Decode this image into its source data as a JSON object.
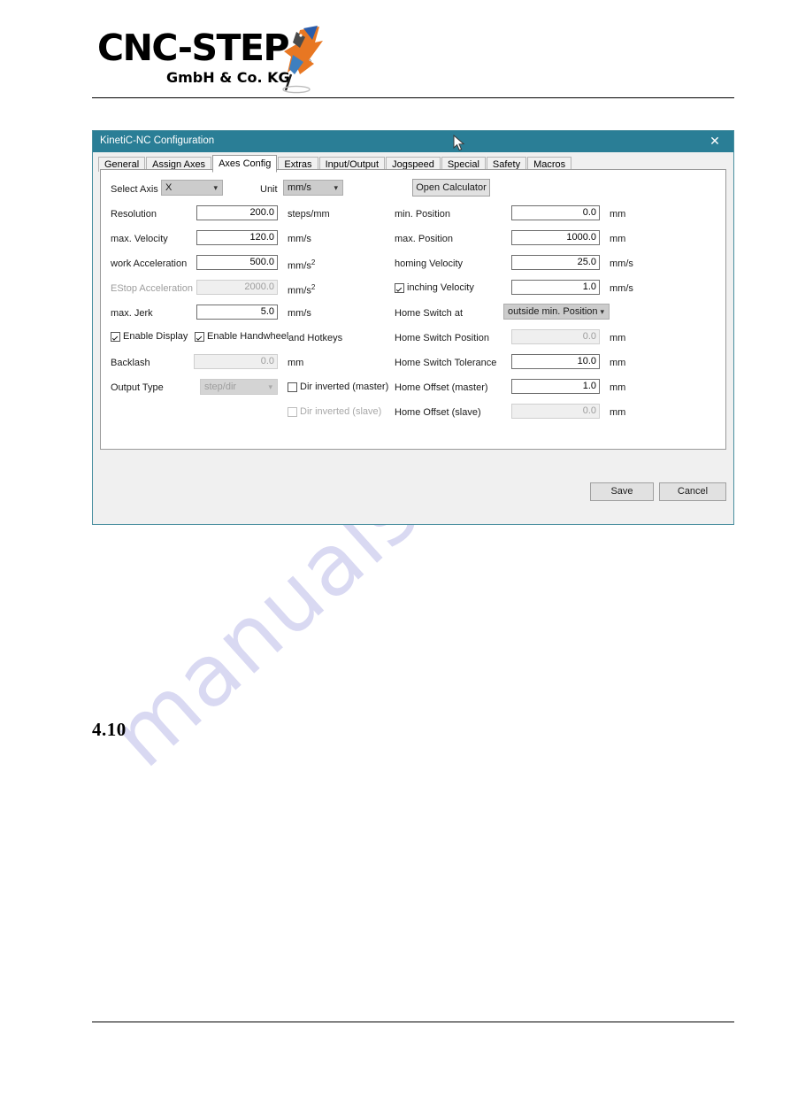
{
  "document": {
    "logo": {
      "main_text": "CNC-STEP",
      "sub_text": "GmbH & Co. KG",
      "registered_mark": "®",
      "bird_icon_name": "kingfisher-logo-icon"
    },
    "watermark_text": "manualshive.com",
    "section_number": "4.10"
  },
  "dialog": {
    "title": "KinetiC-NC Configuration",
    "close_label": "✕",
    "accent_color": "#2a7e96",
    "tabs": [
      {
        "label": "General",
        "selected": false
      },
      {
        "label": "Assign Axes",
        "selected": false
      },
      {
        "label": "Axes Config",
        "selected": true
      },
      {
        "label": "Extras",
        "selected": false
      },
      {
        "label": "Input/Output",
        "selected": false
      },
      {
        "label": "Jogspeed",
        "selected": false
      },
      {
        "label": "Special",
        "selected": false
      },
      {
        "label": "Safety",
        "selected": false
      },
      {
        "label": "Macros",
        "selected": false
      }
    ],
    "toolbar": {
      "select_axis_label": "Select Axis",
      "select_axis_value": "X",
      "unit_label": "Unit",
      "unit_value": "mm/s",
      "open_calculator_label": "Open Calculator"
    },
    "left_column": {
      "resolution": {
        "label": "Resolution",
        "value": "200.0",
        "unit": "steps/mm",
        "enabled": true
      },
      "max_velocity": {
        "label": "max. Velocity",
        "value": "120.0",
        "unit": "mm/s",
        "enabled": true
      },
      "work_acceleration": {
        "label": "work Acceleration",
        "value": "500.0",
        "unit": "mm/s²",
        "enabled": true
      },
      "estop_acceleration": {
        "label": "EStop Acceleration",
        "value": "2000.0",
        "unit": "mm/s²",
        "enabled": false
      },
      "max_jerk": {
        "label": "max. Jerk",
        "value": "5.0",
        "unit": "mm/s",
        "enabled": true
      },
      "enable_display": {
        "label": "Enable Display",
        "checked": true
      },
      "enable_handwheel": {
        "label": "Enable Handwheel",
        "checked": true
      },
      "and_hotkeys": {
        "label": "and Hotkeys"
      },
      "backlash": {
        "label": "Backlash",
        "value": "0.0",
        "unit": "mm",
        "enabled": false
      },
      "output_type": {
        "label": "Output Type",
        "value": "step/dir",
        "enabled": false
      },
      "dir_inverted_master": {
        "label": "Dir inverted (master)",
        "checked": false,
        "enabled": true
      },
      "dir_inverted_slave": {
        "label": "Dir inverted (slave)",
        "checked": false,
        "enabled": false
      }
    },
    "right_column": {
      "min_position": {
        "label": "min. Position",
        "value": "0.0",
        "unit": "mm",
        "enabled": true
      },
      "max_position": {
        "label": "max. Position",
        "value": "1000.0",
        "unit": "mm",
        "enabled": true
      },
      "homing_velocity": {
        "label": "homing Velocity",
        "value": "25.0",
        "unit": "mm/s",
        "enabled": true
      },
      "inching_velocity": {
        "label": "inching Velocity",
        "value": "1.0",
        "unit": "mm/s",
        "checked": true,
        "enabled": true
      },
      "home_switch_at": {
        "label": "Home Switch at",
        "value": "outside min. Position",
        "enabled": true
      },
      "home_switch_position": {
        "label": "Home Switch Position",
        "value": "0.0",
        "unit": "mm",
        "enabled": false
      },
      "home_switch_tolerance": {
        "label": "Home Switch Tolerance",
        "value": "10.0",
        "unit": "mm",
        "enabled": true
      },
      "home_offset_master": {
        "label": "Home Offset (master)",
        "value": "1.0",
        "unit": "mm",
        "enabled": true
      },
      "home_offset_slave": {
        "label": "Home Offset (slave)",
        "value": "0.0",
        "unit": "mm",
        "enabled": false
      }
    },
    "footer": {
      "save_label": "Save",
      "cancel_label": "Cancel"
    }
  }
}
